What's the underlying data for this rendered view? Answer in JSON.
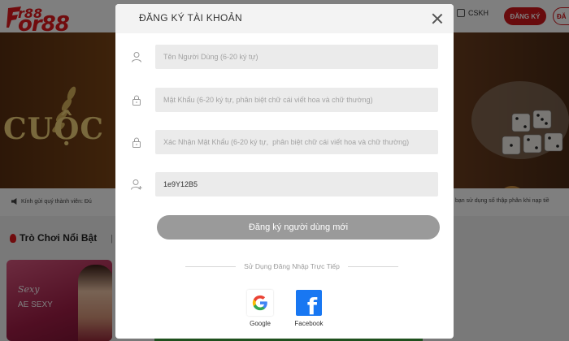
{
  "site": {
    "logo_small": "r88",
    "logo_big": "or88",
    "support_label": "CSKH",
    "register_label": "ĐĂNG KÝ",
    "login_label": "ĐĂ",
    "banner_text": "CUỘC N",
    "notice_left": "Kính gửi quý thành viên: Đú",
    "notice_right": "bạn sử dụng số thập phân khi nạp tiề",
    "games_title": "Trò Chơi Nổi Bật",
    "games_separator": "|",
    "game_card_brand": "Sexy",
    "game_card_label": "AE SEXY"
  },
  "modal": {
    "title": "ĐĂNG KÝ TÀI KHOẢN",
    "username": {
      "placeholder": "Tên Người Dùng (6-20 ký tự)",
      "value": ""
    },
    "password": {
      "placeholder": "Mật Khẩu (6-20 ký tự, phân biệt chữ cái viết hoa và chữ thường)",
      "value": ""
    },
    "confirm_password": {
      "placeholder": "Xác Nhận Mật Khẩu (6-20 ký tự,  phân biệt chữ cái viết hoa và chữ thường)",
      "value": ""
    },
    "referral_code": {
      "placeholder": "",
      "value": "1e9Y12B5"
    },
    "submit_label": "Đăng ký người dùng mới",
    "divider_text": "Sử Dụng Đăng Nhập Trực Tiếp",
    "google_label": "Google",
    "facebook_label": "Facebook",
    "facebook_glyph": "f"
  },
  "colors": {
    "brand_red": "#e3191c",
    "overlay": "rgba(0,0,0,0.5)",
    "button_disabled": "#9a9a9a",
    "facebook_blue": "#1877f2"
  },
  "icons": {
    "username": "user-icon",
    "password": "lock-icon",
    "confirm_password": "lock-icon",
    "referral_code": "user-plus-icon",
    "close": "close-icon"
  }
}
